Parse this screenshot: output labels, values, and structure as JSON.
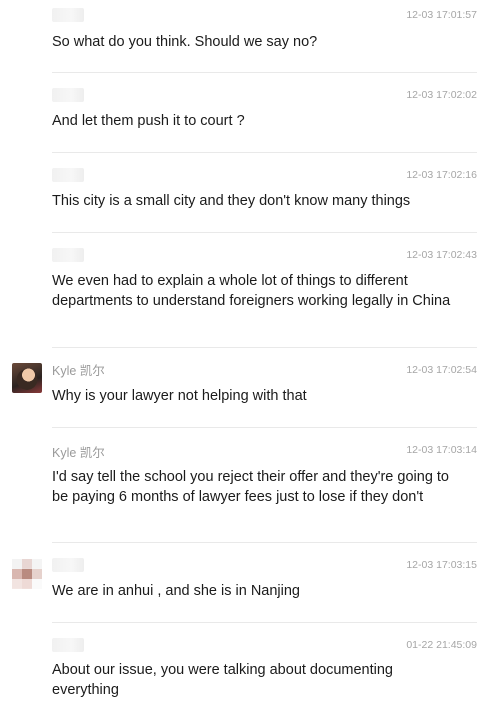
{
  "messages": [
    {
      "sender": "",
      "time": "12-03 17:01:57",
      "text": "So what do you think. Should we say no?"
    },
    {
      "sender": "",
      "time": "12-03 17:02:02",
      "text": "And let them push it to court ?"
    },
    {
      "sender": "",
      "time": "12-03 17:02:16",
      "text": "This city is a small city and they don't know many things"
    },
    {
      "sender": "",
      "time": "12-03 17:02:43",
      "text": "We even had to explain a whole lot of things to different departments to understand foreigners working legally in China"
    },
    {
      "sender": "Kyle 凯尔",
      "time": "12-03 17:02:54",
      "text": "Why is your lawyer not helping with that"
    },
    {
      "sender": "Kyle 凯尔",
      "time": "12-03 17:03:14",
      "text": "I'd say tell the school you reject their offer and they're going to be paying 6 months of lawyer fees just to lose if they don't"
    },
    {
      "sender": "",
      "time": "12-03 17:03:15",
      "text": "We are in anhui , and she is in Nanjing"
    },
    {
      "sender": "",
      "time": "01-22 21:45:09",
      "text": "About our issue, you were talking about documenting everything"
    }
  ]
}
